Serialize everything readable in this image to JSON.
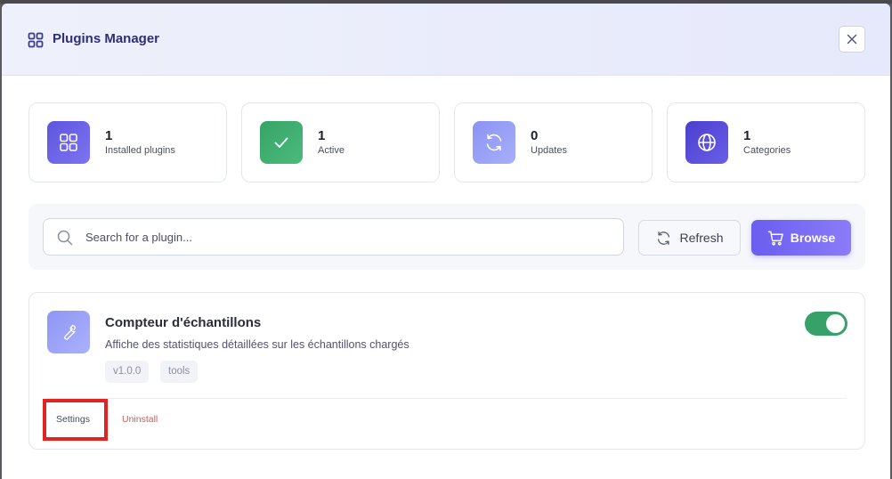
{
  "header": {
    "title": "Plugins Manager",
    "icon": "grid-icon",
    "close_icon": "close-icon"
  },
  "stats": [
    {
      "value": "1",
      "label": "Installed plugins",
      "icon": "grid-icon",
      "color": "#6c63e8"
    },
    {
      "value": "1",
      "label": "Active",
      "icon": "check-icon",
      "color": "#3dae6e"
    },
    {
      "value": "0",
      "label": "Updates",
      "icon": "refresh-icon",
      "color": "#9aa3f7"
    },
    {
      "value": "1",
      "label": "Categories",
      "icon": "globe-icon",
      "color": "#5a4fd8"
    }
  ],
  "toolbar": {
    "search_placeholder": "Search for a plugin...",
    "refresh_label": "Refresh",
    "browse_label": "Browse"
  },
  "plugin": {
    "name": "Compteur d'échantillons",
    "description": "Affiche des statistiques détaillées sur les échantillons chargés",
    "tags": [
      "v1.0.0",
      "tools"
    ],
    "enabled": true,
    "icon": "wrench-icon",
    "settings_label": "Settings",
    "uninstall_label": "Uninstall"
  },
  "colors": {
    "accent": "#6a5df0",
    "toggle_on": "#36a26a",
    "danger": "#e05252",
    "highlight": "#e32222"
  }
}
